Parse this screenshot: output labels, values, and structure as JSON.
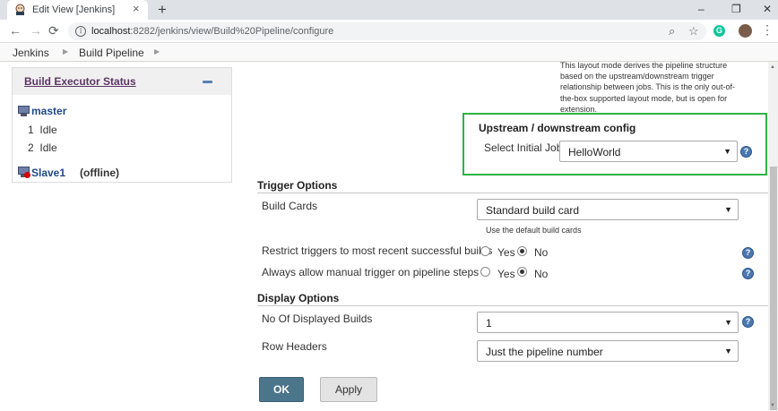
{
  "browser": {
    "tab_title": "Edit View [Jenkins]",
    "tab_close": "×",
    "new_tab": "+",
    "window_controls": {
      "minimize": "–",
      "restore": "❐",
      "close": "✕"
    },
    "nav": {
      "back": "←",
      "forward": "→",
      "reload": "⟳"
    },
    "url_host": "localhost",
    "url_path": ":8282/jenkins/view/Build%20Pipeline/configure",
    "icons": [
      "info-icon",
      "zoom-icon",
      "bookmark-star-icon",
      "grammarly-extension-icon",
      "profile-avatar",
      "menu-kebab-icon"
    ],
    "extension_letter": "G"
  },
  "breadcrumbs": [
    "Jenkins",
    "Build Pipeline"
  ],
  "sidebar": {
    "title": "Build Executor Status",
    "nodes": [
      {
        "name": "master",
        "executors": [
          {
            "num": "1",
            "state": "Idle"
          },
          {
            "num": "2",
            "state": "Idle"
          }
        ]
      },
      {
        "name": "Slave1",
        "status": "(offline)"
      }
    ]
  },
  "main": {
    "layout_description": "This layout mode derives the pipeline structure based on the upstream/downstream trigger relationship between jobs. This is the only out-of-the-box supported layout mode, but is open for extension.",
    "upstream": {
      "title": "Upstream / downstream config",
      "initial_job_label": "Select Initial Job",
      "initial_job_value": "HelloWorld"
    },
    "trigger_options": {
      "title": "Trigger Options",
      "build_cards_label": "Build Cards",
      "build_cards_value": "Standard build card",
      "build_cards_hint": "Use the default build cards",
      "restrict_label": "Restrict triggers to most recent successful builds",
      "manual_label": "Always allow manual trigger on pipeline steps",
      "yes": "Yes",
      "no": "No",
      "restrict_selected": "No",
      "manual_selected": "No"
    },
    "display_options": {
      "title": "Display Options",
      "displayed_builds_label": "No Of Displayed Builds",
      "displayed_builds_value": "1",
      "row_headers_label": "Row Headers",
      "row_headers_value": "Just the pipeline number"
    },
    "buttons": {
      "ok": "OK",
      "apply": "Apply"
    },
    "help_glyph": "?",
    "select_arrow": "▼"
  },
  "colors": {
    "highlight_border": "#2eb342",
    "ok_button": "#4b758b",
    "help_icon": "#4a78b0",
    "sidebar_title": "#5c3566",
    "node_link": "#204a87"
  }
}
